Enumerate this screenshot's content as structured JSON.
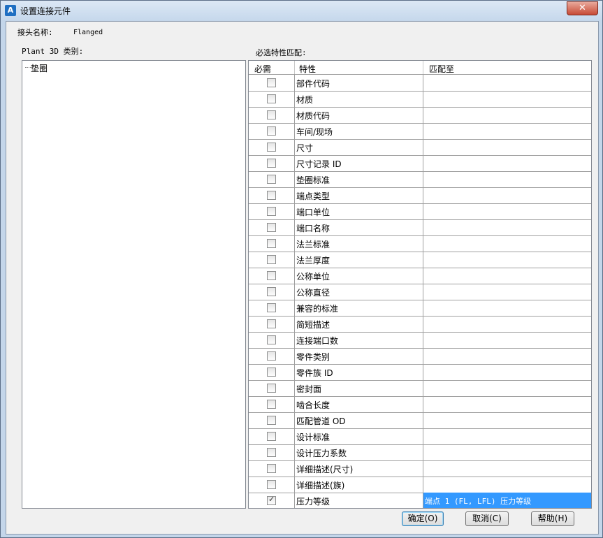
{
  "window": {
    "title": "设置连接元件",
    "close_glyph": "✕",
    "app_icon_glyph": "A"
  },
  "joint": {
    "name_label": "接头名称:",
    "name_value": "Flanged"
  },
  "category": {
    "label": "Plant 3D 类别:",
    "tree_items": [
      "垫圈"
    ]
  },
  "match": {
    "label": "必选特性匹配:",
    "columns": [
      "必需",
      "特性",
      "匹配至"
    ],
    "rows": [
      {
        "required": false,
        "property": "部件代码",
        "match": ""
      },
      {
        "required": false,
        "property": "材质",
        "match": ""
      },
      {
        "required": false,
        "property": "材质代码",
        "match": ""
      },
      {
        "required": false,
        "property": "车间/现场",
        "match": ""
      },
      {
        "required": false,
        "property": "尺寸",
        "match": ""
      },
      {
        "required": false,
        "property": "尺寸记录 ID",
        "match": ""
      },
      {
        "required": false,
        "property": "垫圈标准",
        "match": ""
      },
      {
        "required": false,
        "property": "端点类型",
        "match": ""
      },
      {
        "required": false,
        "property": "端口单位",
        "match": ""
      },
      {
        "required": false,
        "property": "端口名称",
        "match": ""
      },
      {
        "required": false,
        "property": "法兰标准",
        "match": ""
      },
      {
        "required": false,
        "property": "法兰厚度",
        "match": ""
      },
      {
        "required": false,
        "property": "公称单位",
        "match": ""
      },
      {
        "required": false,
        "property": "公称直径",
        "match": ""
      },
      {
        "required": false,
        "property": "兼容的标准",
        "match": ""
      },
      {
        "required": false,
        "property": "简短描述",
        "match": ""
      },
      {
        "required": false,
        "property": "连接端口数",
        "match": ""
      },
      {
        "required": false,
        "property": "零件类别",
        "match": ""
      },
      {
        "required": false,
        "property": "零件族 ID",
        "match": ""
      },
      {
        "required": false,
        "property": "密封面",
        "match": ""
      },
      {
        "required": false,
        "property": "啮合长度",
        "match": ""
      },
      {
        "required": false,
        "property": "匹配管道 OD",
        "match": ""
      },
      {
        "required": false,
        "property": "设计标准",
        "match": ""
      },
      {
        "required": false,
        "property": "设计压力系数",
        "match": ""
      },
      {
        "required": false,
        "property": "详细描述(尺寸)",
        "match": ""
      },
      {
        "required": false,
        "property": "详细描述(族)",
        "match": ""
      },
      {
        "required": true,
        "property": "压力等级",
        "match": "端点 1 (FL, LFL) 压力等级",
        "selected": true
      }
    ]
  },
  "buttons": {
    "ok": "确定(O)",
    "cancel": "取消(C)",
    "help": "帮助(H)"
  },
  "colors": {
    "selection": "#3399ff",
    "titlebar": "#c6d8ec",
    "close": "#c74a35"
  }
}
